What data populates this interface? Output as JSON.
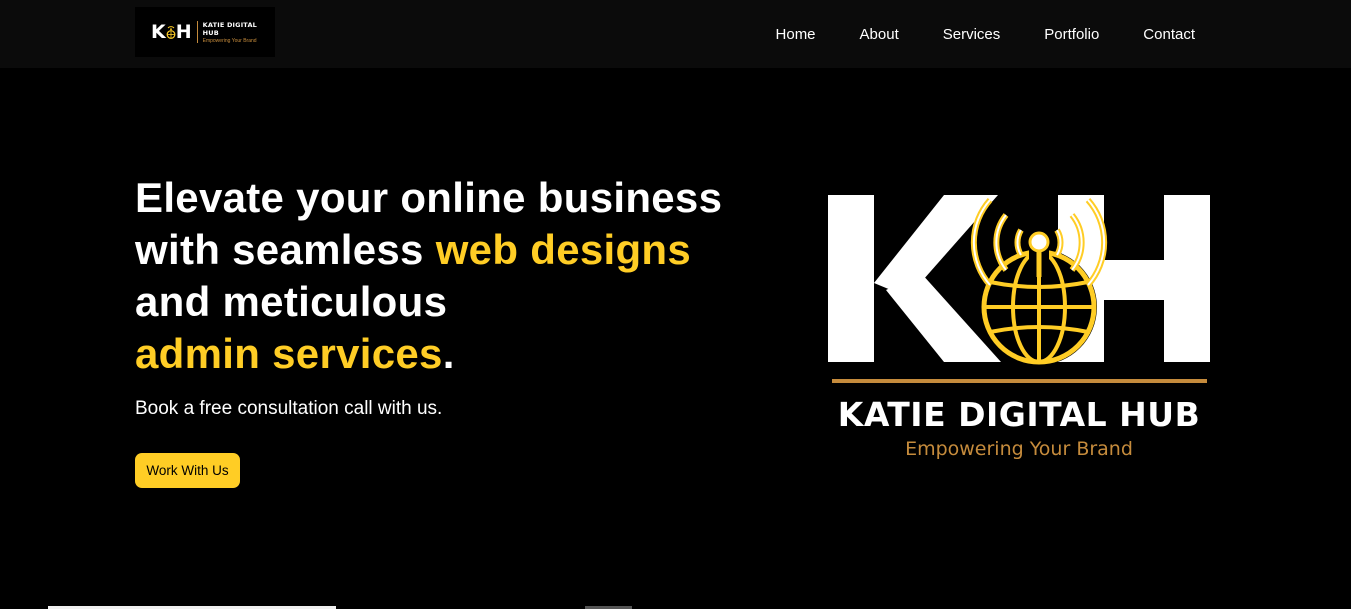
{
  "nav": {
    "logo": {
      "mark_left": "K",
      "mark_right": "H",
      "name": "KATIE DIGITAL HUB",
      "tagline": "Empowering Your Brand"
    },
    "links": [
      "Home",
      "About",
      "Services",
      "Portfolio",
      "Contact"
    ]
  },
  "hero": {
    "headline": {
      "line1": "Elevate your online business",
      "line2_plain": "with seamless ",
      "line2_highlight": "web designs",
      "line3": "and meticulous",
      "line4_highlight": "admin services",
      "line4_end": "."
    },
    "subtitle": "Book a free consultation call with us.",
    "cta_label": "Work With Us"
  },
  "brand_logo": {
    "mark_left": "K",
    "mark_right": "H",
    "name": "KATIE DIGITAL HUB",
    "tagline": "Empowering Your Brand"
  },
  "colors": {
    "accent": "#ffcd25",
    "bronze": "#c58b3c",
    "background": "#000000",
    "navbar": "#0b0b0b"
  }
}
